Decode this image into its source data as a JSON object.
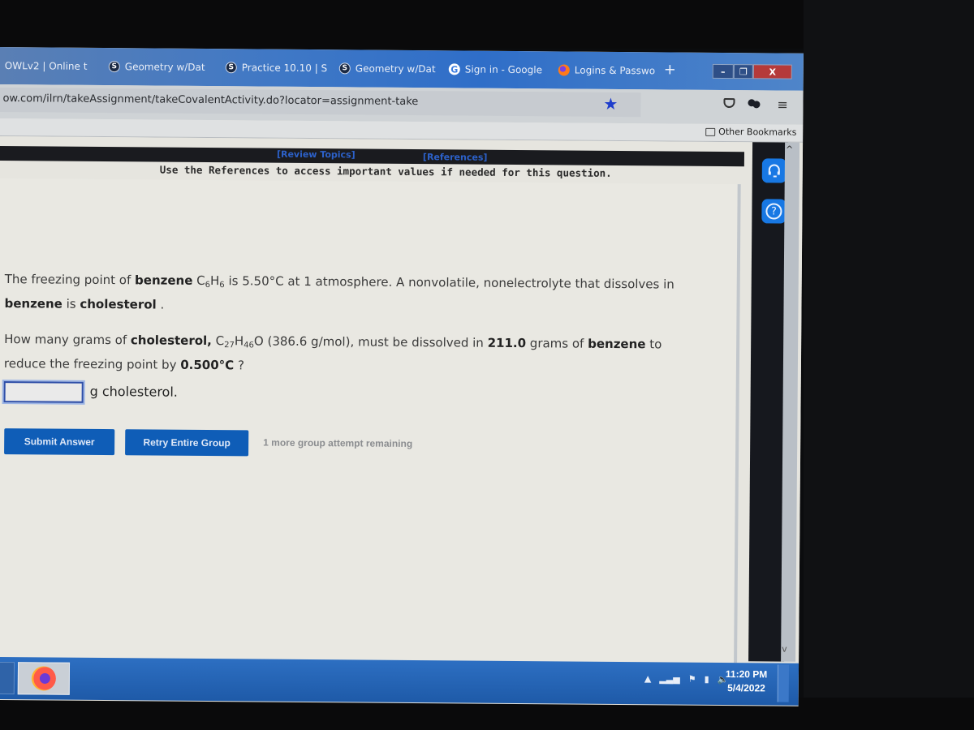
{
  "browser": {
    "tabs": [
      {
        "label": "OWLv2 | Online t",
        "icon": "owl-icon"
      },
      {
        "label": "Geometry w/Dat",
        "icon": "s-icon"
      },
      {
        "label": "Practice 10.10 | S",
        "icon": "s-icon"
      },
      {
        "label": "Geometry w/Dat",
        "icon": "s-icon"
      },
      {
        "label": "Sign in - Google",
        "icon": "google-icon"
      },
      {
        "label": "Logins & Passwo",
        "icon": "firefox-icon"
      }
    ],
    "new_tab_label": "+",
    "window_controls": {
      "minimize": "–",
      "maximize": "❐",
      "close": "X"
    },
    "url": "ow.com/ilrn/takeAssignment/takeCovalentActivity.do?locator=assignment-take",
    "bookmark_star": "★",
    "menu_glyph": "≡",
    "other_bookmarks": "Other Bookmarks"
  },
  "assignment": {
    "review_topics": "[Review Topics]",
    "references": "[References]",
    "instructions": "Use the References to access important values if needed for this question.",
    "para1": {
      "t1": "The freezing point of ",
      "b1": "benzene",
      "t2": " ",
      "formula": "C6H6",
      "t3": " is ",
      "temp": "5.50°C",
      "t4": " at 1 atmosphere. A nonvolatile, nonelectrolyte that dissolves in",
      "b2": "benzene",
      "t5": " is ",
      "b3": "cholesterol",
      "t6": " ."
    },
    "para2": {
      "t1": "How many grams of ",
      "b1": "cholesterol,",
      "formula": "C27H46O",
      "molar_mass": "(386.6",
      "t2": " g/mol), must be dissolved in ",
      "mass": "211.0",
      "t3": " grams of ",
      "b2": "benzene",
      "t4": " to",
      "t5": "reduce the freezing point by ",
      "delta": "0.500°C",
      "t6": " ?"
    },
    "answer": {
      "value": "",
      "unit": "g cholesterol."
    },
    "submit_label": "Submit Answer",
    "retry_label": "Retry Entire Group",
    "attempts_text": "1 more group attempt remaining"
  },
  "side_panel": {
    "support_icon": "headset-icon",
    "help_glyph": "?"
  },
  "taskbar": {
    "tray_arrow": "▲",
    "signal": "▂▃▅",
    "time": "11:20 PM",
    "date": "5/4/2022"
  }
}
